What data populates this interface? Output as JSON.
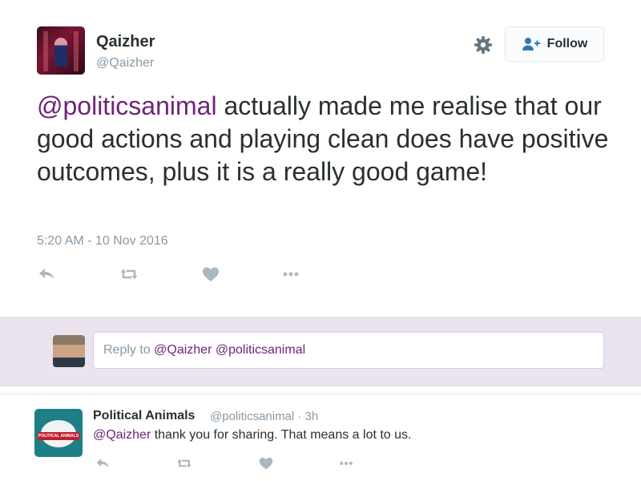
{
  "tweet": {
    "display_name": "Qaizher",
    "handle": "@Qaizher",
    "follow_label": "Follow",
    "mention": "@politicsanimal",
    "text_rest": " actually made me realise that our good actions and playing clean does have positive outcomes, plus it is a really good game!",
    "timestamp": "5:20 AM - 10 Nov 2016",
    "icons": [
      "reply-icon",
      "retweet-icon",
      "like-icon",
      "more-icon"
    ]
  },
  "reply_box": {
    "prefix": "Reply to ",
    "mention_1": "@Qaizher",
    "mention_2": "@politicsanimal"
  },
  "reply_tweet": {
    "display_name": "Political Animals",
    "meta": "@politicsanimal · 3h",
    "mention": "@Qaizher",
    "text_rest": " thank you for sharing. That means a lot to us.",
    "avatar_label": "POLITICAL ANIMALS"
  },
  "colors": {
    "mention": "#6e2479",
    "reply_bar_bg": "#ebe3ee",
    "muted": "#8899a6",
    "follow_icon": "#2b7bb9"
  }
}
